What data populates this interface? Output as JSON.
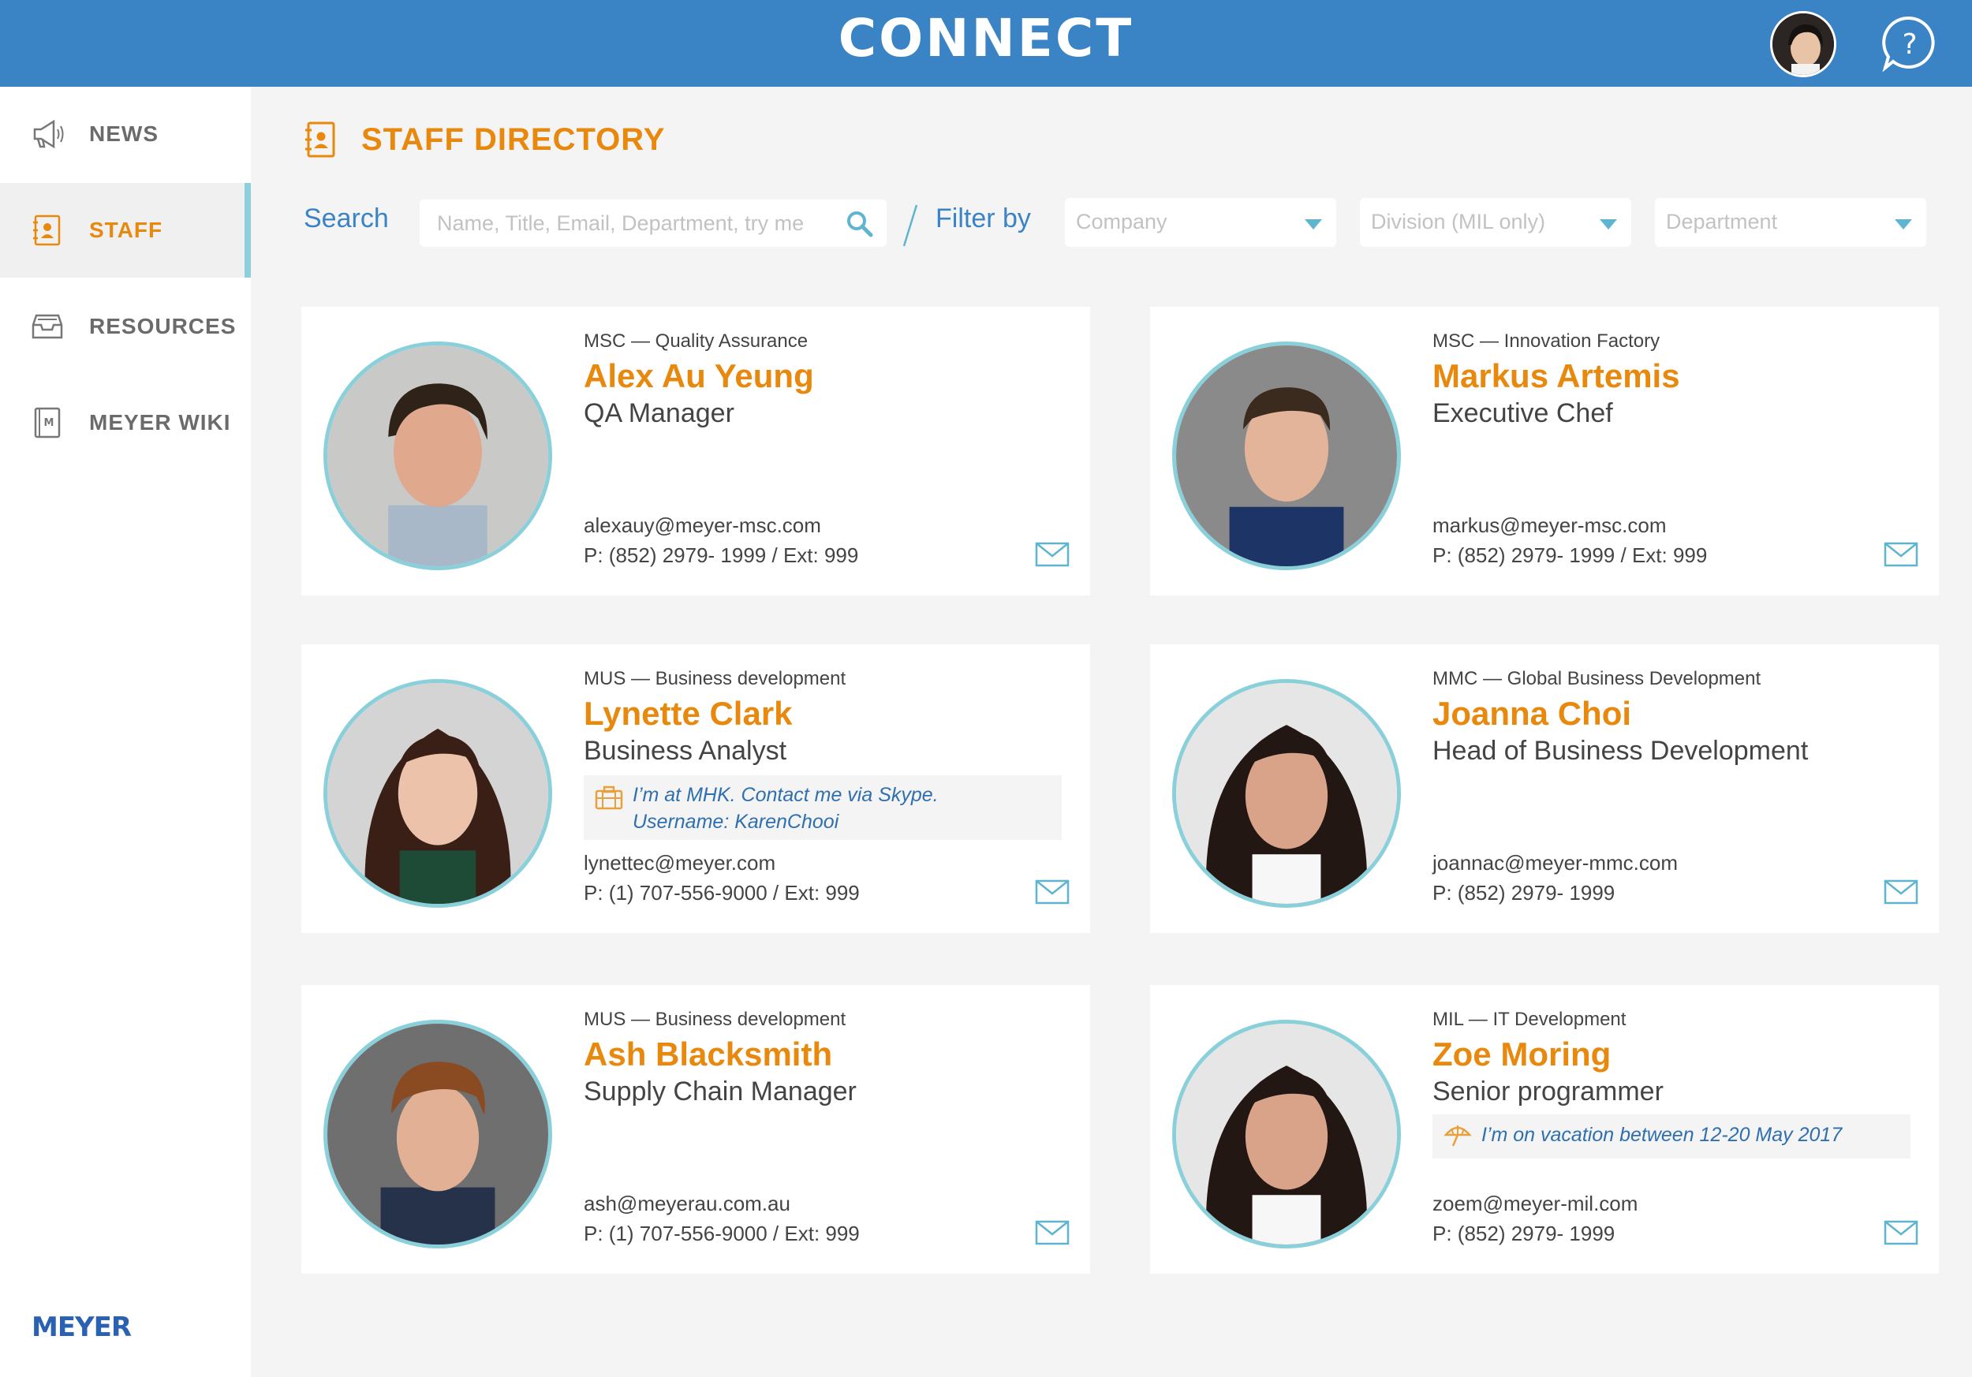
{
  "app": {
    "logo": "CONNECT",
    "brand": "MEYER"
  },
  "colors": {
    "topbar": "#3a84c6",
    "accent_orange": "#e8880c",
    "accent_blue": "#3a84c6",
    "photo_ring": "#8ad0da"
  },
  "sidebar": {
    "items": [
      {
        "label": "NEWS",
        "icon": "megaphone-icon",
        "active": false
      },
      {
        "label": "STAFF",
        "icon": "address-book-icon",
        "active": true
      },
      {
        "label": "RESOURCES",
        "icon": "inbox-tray-icon",
        "active": false
      },
      {
        "label": "MEYER WIKI",
        "icon": "wiki-book-icon",
        "active": false
      }
    ]
  },
  "page": {
    "title": "STAFF DIRECTORY"
  },
  "search": {
    "label": "Search",
    "placeholder": "Name, Title, Email, Department, try me"
  },
  "filter": {
    "label": "Filter by",
    "company": "Company",
    "division": "Division (MIL only)",
    "department": "Department"
  },
  "staff": [
    {
      "dept": "MSC — Quality Assurance",
      "name": "Alex Au Yeung",
      "title": "QA Manager",
      "email": "alexauy@meyer-msc.com",
      "phone": "P: (852) 2979- 1999 / Ext: 999"
    },
    {
      "dept": "MSC — Innovation Factory",
      "name": "Markus Artemis",
      "title": "Executive Chef",
      "email": "markus@meyer-msc.com",
      "phone": "P: (852) 2979- 1999 / Ext: 999"
    },
    {
      "dept": "MUS — Business development",
      "name": "Lynette Clark",
      "title": "Business Analyst",
      "status_line1": "I’m at MHK. Contact me via Skype.",
      "status_line2": "Username: KarenChooi",
      "status_icon": "briefcase-icon",
      "email": "lynettec@meyer.com",
      "phone": "P: (1) 707-556-9000  / Ext: 999"
    },
    {
      "dept": "MMC — Global Business Development",
      "name": "Joanna Choi",
      "title": "Head of Business Development",
      "email": "joannac@meyer-mmc.com",
      "phone": "P: (852) 2979- 1999"
    },
    {
      "dept": "MUS — Business development",
      "name": "Ash Blacksmith",
      "title": "Supply Chain Manager",
      "email": "ash@meyerau.com.au",
      "phone": "P: (1) 707-556-9000  / Ext: 999"
    },
    {
      "dept": "MIL — IT Development",
      "name": "Zoe Moring",
      "title": "Senior programmer",
      "status_line1": "I’m on vacation between 12-20 May 2017",
      "status_icon": "beach-umbrella-icon",
      "email": "zoem@meyer-mil.com",
      "phone": "P: (852) 2979- 1999"
    }
  ]
}
